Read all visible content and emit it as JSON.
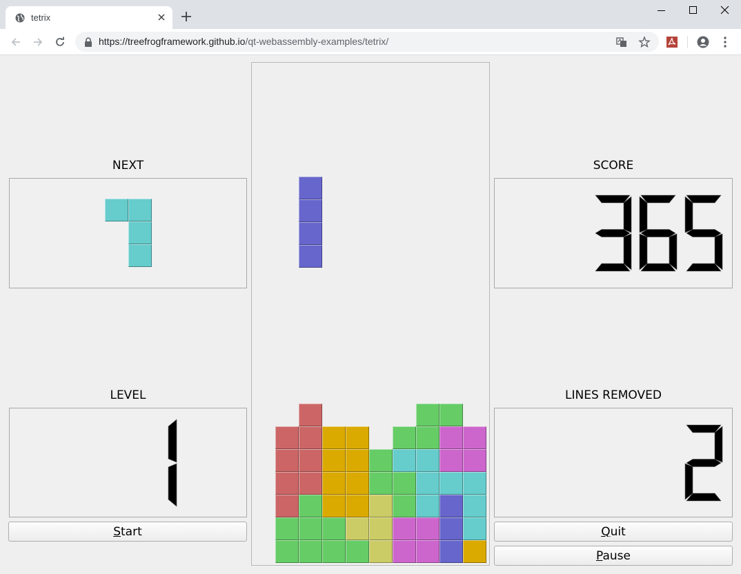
{
  "browser": {
    "tab_title": "tetrix",
    "url_host": "https://treefrogframework.github.io",
    "url_path": "/qt-webassembly-examples/tetrix/"
  },
  "game": {
    "next_label": "NEXT",
    "score_label": "SCORE",
    "level_label": "LEVEL",
    "lines_label": "LINES REMOVED",
    "score_value": "365",
    "level_value": "1",
    "lines_value": "2",
    "start_button": {
      "mnemonic": "S",
      "rest": "tart"
    },
    "quit_button": {
      "mnemonic": "Q",
      "rest": "uit"
    },
    "pause_button": {
      "mnemonic": "P",
      "rest": "ause"
    },
    "colors": {
      "red": "#cc6666",
      "green": "#66cc66",
      "blue": "#6666cc",
      "yellow": "#cccc66",
      "magenta": "#cc66cc",
      "cyan": "#66cccc",
      "orange": "#daaa00"
    },
    "next_piece": {
      "color": "cyan",
      "cells": [
        [
          0,
          0
        ],
        [
          1,
          0
        ],
        [
          1,
          1
        ],
        [
          1,
          2
        ]
      ]
    },
    "falling_piece": {
      "color": "blue",
      "cells": [
        [
          1,
          5
        ],
        [
          1,
          6
        ],
        [
          1,
          7
        ],
        [
          1,
          8
        ]
      ]
    },
    "board_cells": [
      [
        1,
        15,
        "red"
      ],
      [
        6,
        15,
        "green"
      ],
      [
        7,
        15,
        "green"
      ],
      [
        0,
        16,
        "red"
      ],
      [
        1,
        16,
        "red"
      ],
      [
        2,
        16,
        "orange"
      ],
      [
        3,
        16,
        "orange"
      ],
      [
        5,
        16,
        "green"
      ],
      [
        6,
        16,
        "green"
      ],
      [
        7,
        16,
        "magenta"
      ],
      [
        8,
        16,
        "magenta"
      ],
      [
        0,
        17,
        "red"
      ],
      [
        1,
        17,
        "red"
      ],
      [
        2,
        17,
        "orange"
      ],
      [
        3,
        17,
        "orange"
      ],
      [
        4,
        17,
        "green"
      ],
      [
        5,
        17,
        "cyan"
      ],
      [
        6,
        17,
        "cyan"
      ],
      [
        7,
        17,
        "magenta"
      ],
      [
        8,
        17,
        "magenta"
      ],
      [
        0,
        18,
        "red"
      ],
      [
        1,
        18,
        "red"
      ],
      [
        2,
        18,
        "orange"
      ],
      [
        3,
        18,
        "orange"
      ],
      [
        4,
        18,
        "green"
      ],
      [
        5,
        18,
        "green"
      ],
      [
        6,
        18,
        "cyan"
      ],
      [
        7,
        18,
        "cyan"
      ],
      [
        8,
        18,
        "cyan"
      ],
      [
        0,
        19,
        "red"
      ],
      [
        1,
        19,
        "green"
      ],
      [
        2,
        19,
        "orange"
      ],
      [
        3,
        19,
        "orange"
      ],
      [
        4,
        19,
        "yellow"
      ],
      [
        5,
        19,
        "green"
      ],
      [
        6,
        19,
        "cyan"
      ],
      [
        7,
        19,
        "blue"
      ],
      [
        8,
        19,
        "cyan"
      ],
      [
        0,
        20,
        "green"
      ],
      [
        1,
        20,
        "green"
      ],
      [
        2,
        20,
        "green"
      ],
      [
        3,
        20,
        "yellow"
      ],
      [
        4,
        20,
        "yellow"
      ],
      [
        5,
        20,
        "magenta"
      ],
      [
        6,
        20,
        "magenta"
      ],
      [
        7,
        20,
        "blue"
      ],
      [
        8,
        20,
        "cyan"
      ],
      [
        0,
        21,
        "green"
      ],
      [
        1,
        21,
        "green"
      ],
      [
        2,
        21,
        "green"
      ],
      [
        3,
        21,
        "green"
      ],
      [
        4,
        21,
        "yellow"
      ],
      [
        5,
        21,
        "magenta"
      ],
      [
        6,
        21,
        "magenta"
      ],
      [
        7,
        21,
        "blue"
      ],
      [
        8,
        21,
        "orange"
      ]
    ]
  }
}
